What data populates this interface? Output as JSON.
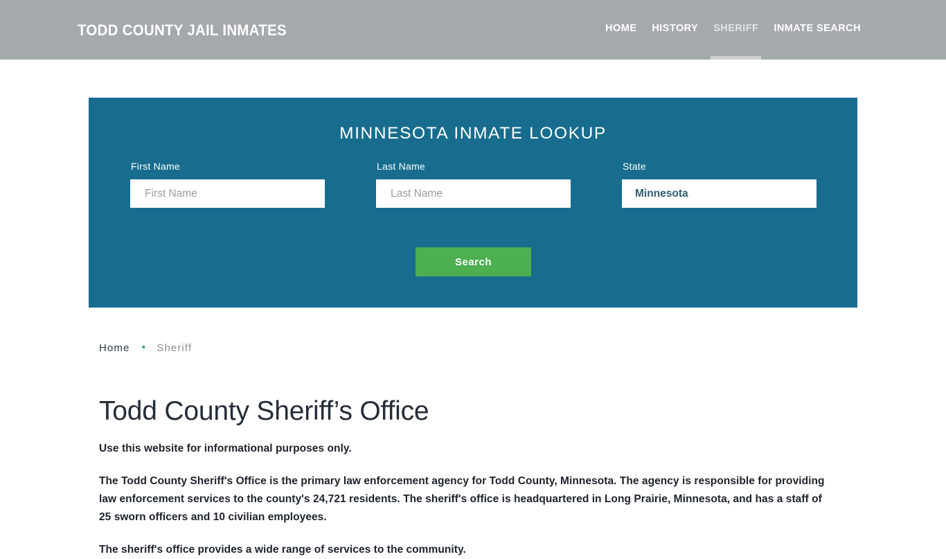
{
  "header": {
    "brand": "TODD COUNTY JAIL INMATES",
    "nav": [
      {
        "label": "HOME",
        "active": false
      },
      {
        "label": "HISTORY",
        "active": false
      },
      {
        "label": "SHERIFF",
        "active": true
      },
      {
        "label": "INMATE SEARCH",
        "active": false
      }
    ],
    "background_color": "#a4a9ac"
  },
  "lookup": {
    "title": "MINNESOTA INMATE LOOKUP",
    "panel_color": "#186d8e",
    "first_name": {
      "label": "First Name",
      "placeholder": "First Name",
      "value": ""
    },
    "last_name": {
      "label": "Last Name",
      "placeholder": "Last Name",
      "value": ""
    },
    "state": {
      "label": "State",
      "selected": "Minnesota",
      "options": [
        "Minnesota"
      ]
    },
    "search_button": {
      "label": "Search",
      "color": "#4caf50"
    }
  },
  "breadcrumb": {
    "home_label": "Home",
    "separator": "•",
    "current_label": "Sheriff",
    "separator_color": "#2f8f8f"
  },
  "page": {
    "title": "Todd County Sheriff’s Office",
    "note": "Use this website for informational purposes only.",
    "intro_paragraph": "The Todd County Sheriff's Office is the primary law enforcement agency for Todd County, Minnesota. The agency is responsible for providing law enforcement services to the county's 24,721 residents. The sheriff's office is headquartered in Long Prairie, Minnesota, and has a staff of 25 sworn officers and 10 civilian employees.",
    "next_paragraph": "The sheriff's office provides a wide range of services to the community."
  }
}
